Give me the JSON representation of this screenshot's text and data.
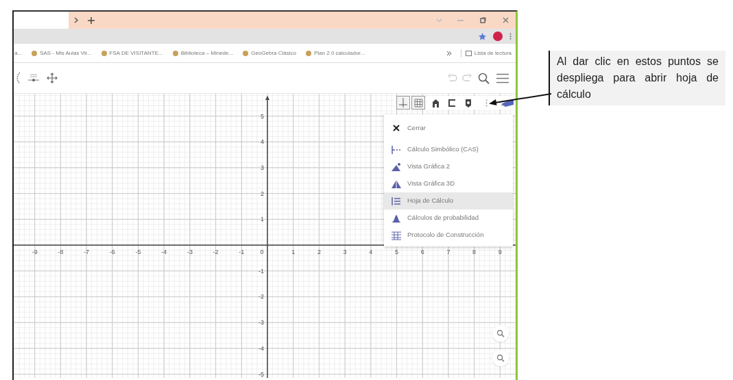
{
  "bookmarks": [
    {
      "label": "a..."
    },
    {
      "label": "SAS - Mis Aulas Vir..."
    },
    {
      "label": "FSA DE VISITANTE..."
    },
    {
      "label": "Biblioteca – Minede..."
    },
    {
      "label": "GeoGebra Clásico"
    },
    {
      "label": "Plan 2.0 calculador..."
    }
  ],
  "reading_list": "Lista de lectura",
  "style_bar": {
    "axes_selected": true,
    "grid_selected": true
  },
  "menu": [
    {
      "kind": "close",
      "label": "Cerrar",
      "selected": false
    },
    {
      "kind": "cas",
      "label": "Cálculo Simbólico (CAS)",
      "selected": false
    },
    {
      "kind": "graphics2",
      "label": "Vista Gráfica 2",
      "selected": false
    },
    {
      "kind": "graphics3d",
      "label": "Vista Gráfica 3D",
      "selected": false
    },
    {
      "kind": "spreadsheet",
      "label": "Hoja de Cálculo",
      "selected": true
    },
    {
      "kind": "probability",
      "label": "Cálculos de probabilidad",
      "selected": false
    },
    {
      "kind": "protocol",
      "label": "Protocolo de Construcción",
      "selected": false
    }
  ],
  "graphics_view": {
    "x_labels": [
      "-9",
      "-8",
      "-7",
      "-6",
      "-5",
      "-4",
      "-3",
      "-2",
      "-1",
      "0",
      "1",
      "2",
      "3",
      "4",
      "5",
      "6",
      "7",
      "8",
      "9"
    ],
    "y_labels": [
      "5",
      "4",
      "3",
      "2",
      "1",
      "-1",
      "-2",
      "-3",
      "-4",
      "-5"
    ]
  },
  "annotation": "Al dar clic en estos puntos se despliega para abrir hoja de cálculo"
}
